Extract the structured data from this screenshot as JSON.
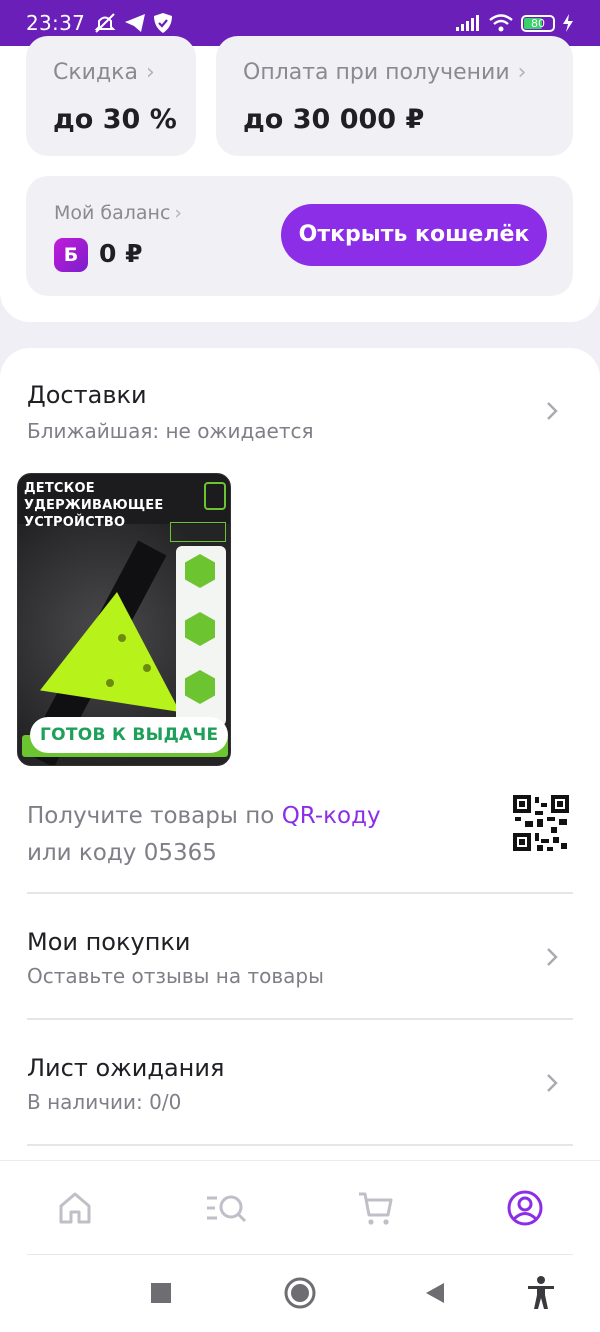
{
  "status_bar": {
    "time": "23:37",
    "battery": "80",
    "icons": [
      "mute-icon",
      "telegram-icon",
      "shield-icon",
      "signal-icon",
      "wifi-icon",
      "battery-icon",
      "charging-icon"
    ]
  },
  "promo": {
    "discount_label": "Скидка",
    "discount_value": "до 30 %",
    "cod_label": "Оплата при получении",
    "cod_value": "до 30 000 ₽"
  },
  "balance": {
    "label": "Мой баланс",
    "badge": "Б",
    "value": "0 ₽",
    "wallet_button": "Открыть кошелёк"
  },
  "deliveries": {
    "title": "Доставки",
    "subtitle": "Ближайшая: не ожидается",
    "product": {
      "image_title": "ДЕТСКОЕ\nУДЕРЖИВАЮЩЕЕ\nУСТРОЙСТВО",
      "status_badge": "ГОТОВ К ВЫДАЧЕ",
      "colors": {
        "accent_green": "#6cc530",
        "product_lime": "#b7f21a",
        "badge_text": "#1fa05a"
      }
    },
    "pickup_prefix": "Получите товары по ",
    "pickup_link": "QR-коду",
    "pickup_code_line": "или коду 05365"
  },
  "purchases": {
    "title": "Мои покупки",
    "subtitle": "Оставьте отзывы на товары"
  },
  "waitlist": {
    "title": "Лист ожидания",
    "subtitle": "В наличии: 0/0"
  },
  "tabs": [
    {
      "name": "home-icon",
      "active": false
    },
    {
      "name": "catalog-search-icon",
      "active": false
    },
    {
      "name": "cart-icon",
      "active": false
    },
    {
      "name": "profile-icon",
      "active": true
    }
  ],
  "colors": {
    "status_bar": "#6a1fb8",
    "accent": "#8c2ee8",
    "tab_inactive": "#bfbfc7",
    "background": "#f0eff5"
  }
}
